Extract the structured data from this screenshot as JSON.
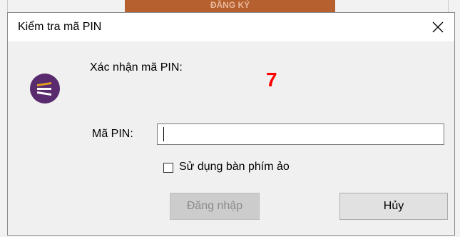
{
  "background": {
    "button_label": "ĐĂNG KÝ"
  },
  "dialog": {
    "title": "Kiểm tra mã PIN",
    "close_icon": "close-icon",
    "logo_icon": "tpbank-logo",
    "confirm_label": "Xác nhận mã PIN:",
    "otp_code": "7",
    "otp_color": "#ff0000",
    "pin_label": "Mã PIN:",
    "pin_value": "",
    "virtual_keyboard_label": "Sử dụng bàn phím ảo",
    "virtual_keyboard_checked": false,
    "login_label": "Đăng nhập",
    "login_enabled": false,
    "cancel_label": "Hủy"
  },
  "colors": {
    "logo_purple": "#5a2a6e",
    "logo_gold": "#e0a020"
  }
}
